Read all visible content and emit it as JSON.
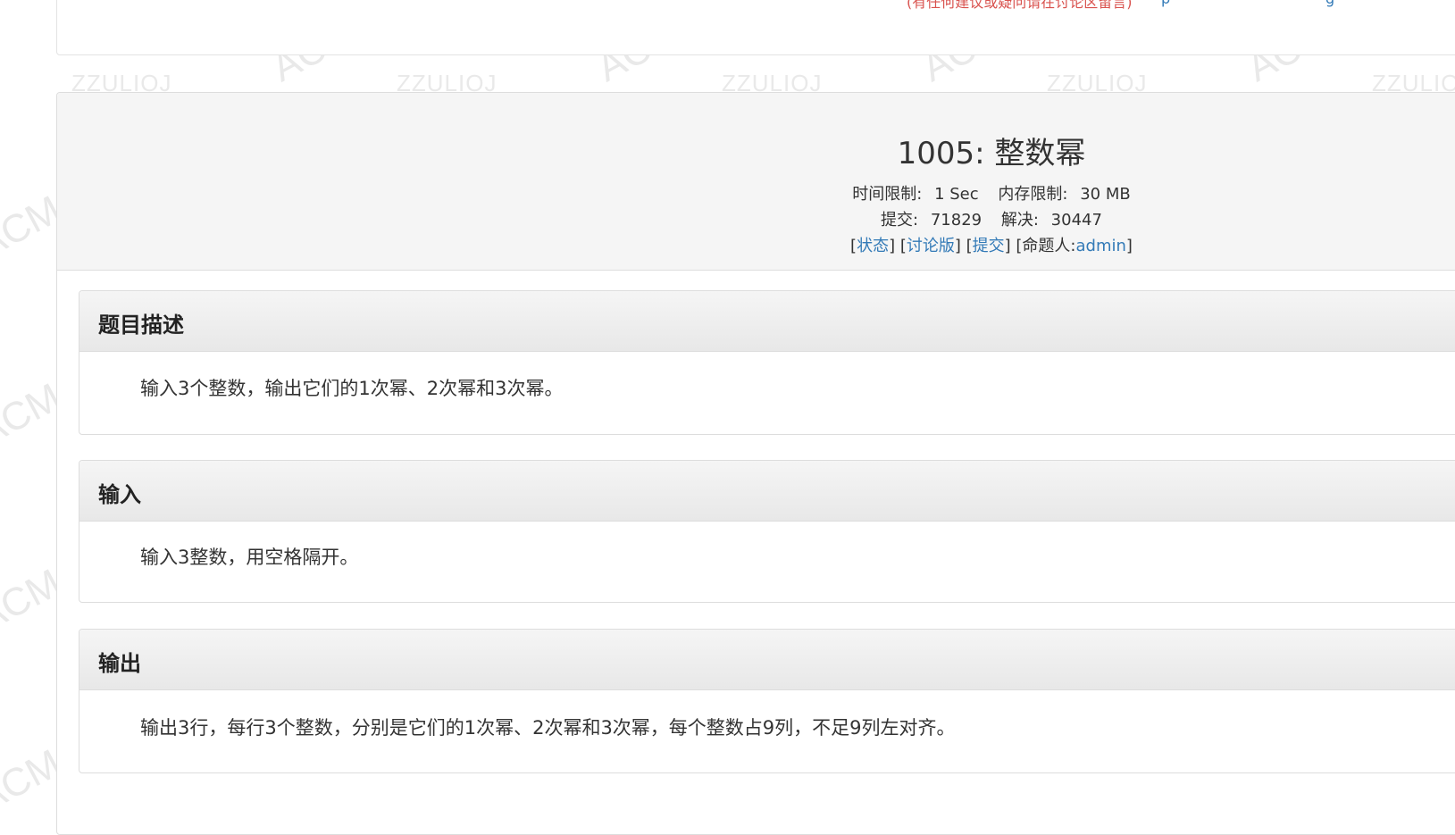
{
  "watermark": {
    "site": "ZZULIOJ",
    "club": "ACM"
  },
  "top_bar": {
    "notice": "(有任何建议或疑问请在讨论区留言)",
    "link_text": "p",
    "link_text_2": "g"
  },
  "problem": {
    "title": "1005: 整数幂",
    "time_limit_label": "时间限制:",
    "time_limit_value": "1 Sec",
    "memory_limit_label": "内存限制:",
    "memory_limit_value": "30 MB",
    "submit_label": "提交:",
    "submit_count": "71829",
    "solved_label": "解决:",
    "solved_count": "30447",
    "links": {
      "status": "状态",
      "discuss": "讨论版",
      "submit": "提交",
      "author_label": "命题人:",
      "author": "admin"
    }
  },
  "sections": {
    "description": {
      "title": "题目描述",
      "text": "输入3个整数，输出它们的1次幂、2次幂和3次幂。"
    },
    "input": {
      "title": "输入",
      "text": "输入3整数，用空格隔开。"
    },
    "output": {
      "title": "输出",
      "text": "输出3行，每行3个整数，分别是它们的1次幂、2次幂和3次幂，每个整数占9列，不足9列左对齐。"
    }
  }
}
